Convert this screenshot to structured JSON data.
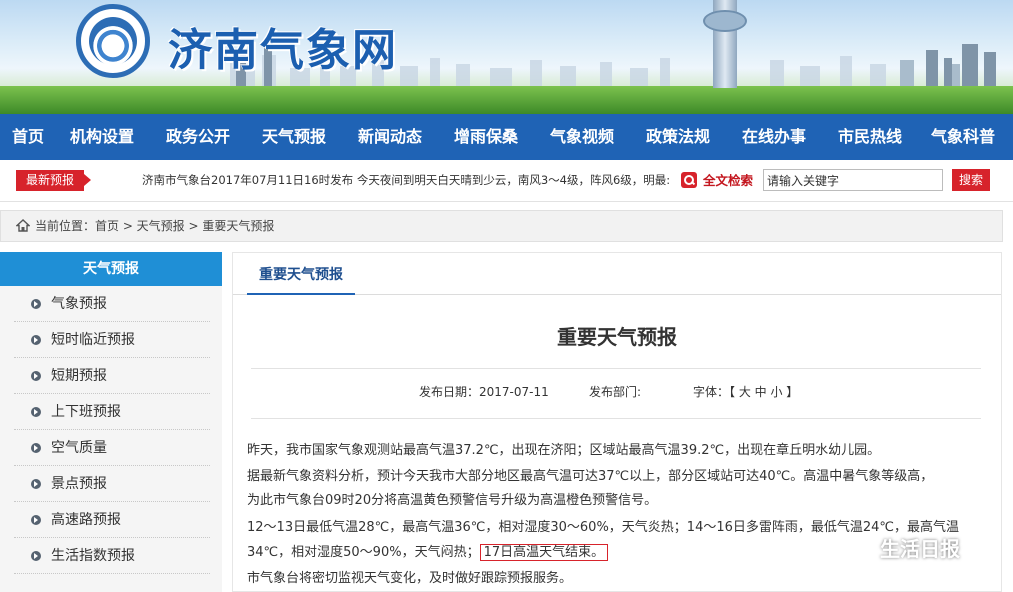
{
  "header": {
    "site_title": "济南气象网"
  },
  "nav": {
    "items": [
      "首页",
      "机构设置",
      "政务公开",
      "天气预报",
      "新闻动态",
      "增雨保桑",
      "气象视频",
      "政策法规",
      "在线办事",
      "市民热线",
      "气象科普"
    ]
  },
  "news_bar": {
    "latest_label": "最新预报",
    "ticker_text": "济南市气象台2017年07月11日16时发布 今天夜间到明天白天晴到少云，南风3～4级，阵风6级，明最:",
    "search_label": "全文检索",
    "search_value": "请输入关键字",
    "search_button": "搜索"
  },
  "breadcrumb": {
    "text": "当前位置：首页 > 天气预报 > 重要天气预报"
  },
  "sidebar": {
    "title": "天气预报",
    "items": [
      "气象预报",
      "短时临近预报",
      "短期预报",
      "上下班预报",
      "空气质量",
      "景点预报",
      "高速路预报",
      "生活指数预报"
    ]
  },
  "main": {
    "tab_label": "重要天气预报",
    "article_title": "重要天气预报",
    "publish_date": "发布日期：2017-07-11",
    "publish_dept": "发布部门:",
    "font_size": "字体：【 大 中 小 】",
    "para1": "昨天，我市国家气象观测站最高气温37.2℃，出现在济阳；区域站最高气温39.2℃，出现在章丘明水幼儿园。",
    "para2a": "据最新气象资料分析，预计今天我市大部分地区最高气温可达37℃以上，部分区域站可达40℃。高温中暑气象等级高，",
    "para2b": "为此市气象台09时20分将高温黄色预警信号升级为高温橙色预警信号。",
    "para3a": "12～13日最低气温28℃，最高气温36℃，相对湿度30～60%，天气炎热；14～16日多雷阵雨，最低气温24℃，最高气温",
    "para3b": "34℃，相对湿度50～90%，天气闷热；",
    "para3c": "17日高温天气结束。",
    "para4": "市气象台将密切监视天气变化，及时做好跟踪预报服务。"
  },
  "watermark": {
    "text": "生活日报"
  }
}
